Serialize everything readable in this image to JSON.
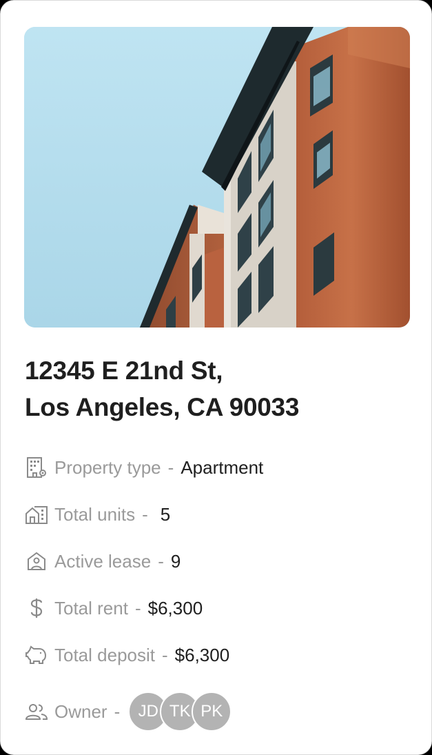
{
  "property": {
    "address_line1": "12345 E 21nd St,",
    "address_line2": "Los Angeles, CA 90033",
    "image_alt": "apartment-building-photo"
  },
  "details": [
    {
      "icon": "building-gear-icon",
      "label": "Property type",
      "separator": "-",
      "value": "Apartment"
    },
    {
      "icon": "house-units-icon",
      "label": "Total units",
      "separator": "-",
      "value": "5"
    },
    {
      "icon": "person-house-icon",
      "label": "Active lease",
      "separator": "-",
      "value": "9"
    },
    {
      "icon": "dollar-icon",
      "label": "Total rent",
      "separator": "-",
      "value": "$6,300"
    },
    {
      "icon": "piggy-bank-icon",
      "label": "Total deposit",
      "separator": "-",
      "value": "$6,300"
    }
  ],
  "owner": {
    "icon": "people-icon",
    "label": "Owner",
    "separator": "-",
    "avatars": [
      "JD",
      "TK",
      "PK"
    ]
  },
  "colors": {
    "label": "#9a9a9a",
    "value": "#1f1f1f",
    "avatar_bg": "#b3b3b3",
    "sky": "#b9e2f0",
    "brick": "#b4623f"
  }
}
